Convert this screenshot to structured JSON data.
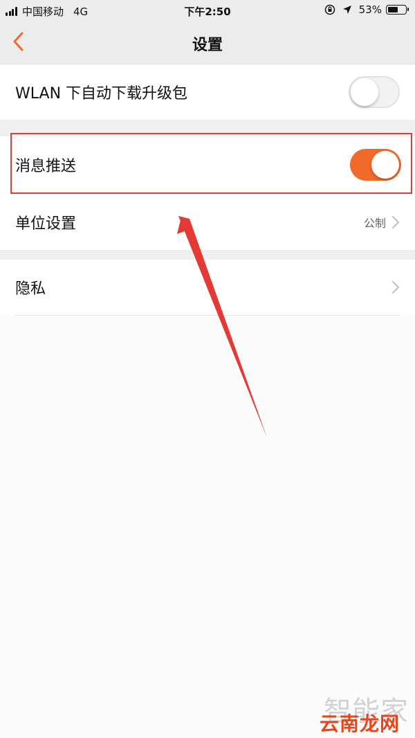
{
  "status_bar": {
    "carrier": "中国移动",
    "network": "4G",
    "time": "下午2:50",
    "battery": "53%",
    "battery_level": 0.53
  },
  "nav": {
    "title": "设置",
    "back_icon": "chevron-left-icon"
  },
  "settings": {
    "wlan": {
      "label": "WLAN 下自动下载升级包",
      "enabled": false
    },
    "push": {
      "label": "消息推送",
      "enabled": true
    },
    "units": {
      "label": "单位设置",
      "value": "公制"
    },
    "privacy": {
      "label": "隐私"
    }
  },
  "colors": {
    "accent": "#f16a2a",
    "annotation": "#e53935",
    "background": "#fbfbfb"
  },
  "watermark": {
    "line1": "智能家",
    "line2": "云南龙网"
  }
}
